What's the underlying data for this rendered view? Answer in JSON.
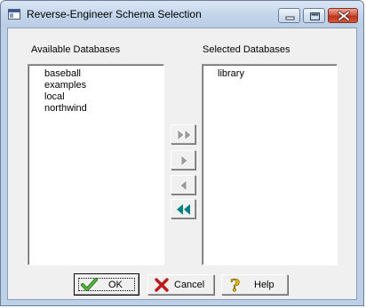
{
  "window": {
    "title": "Reverse-Engineer Schema Selection",
    "icons": {
      "app": "app-window-icon",
      "minimize": "minimize-icon",
      "maximize": "maximize-icon",
      "close": "close-icon"
    }
  },
  "available": {
    "label": "Available Databases",
    "items": [
      "baseball",
      "examples",
      "local",
      "northwind"
    ]
  },
  "selected": {
    "label": "Selected Databases",
    "items": [
      "library"
    ]
  },
  "transfer_buttons": [
    {
      "name": "add-all-button",
      "icon": "double-right-arrow-icon"
    },
    {
      "name": "add-selected-button",
      "icon": "right-arrow-icon"
    },
    {
      "name": "remove-selected-button",
      "icon": "left-arrow-icon"
    },
    {
      "name": "remove-all-button",
      "icon": "double-left-arrow-icon"
    }
  ],
  "buttons": {
    "ok_label": "OK",
    "cancel_label": "Cancel",
    "help_label": "Help"
  },
  "colors": {
    "ok_check": "#3a9a2a",
    "cancel_x": "#c01818",
    "help_q": "#e8c000",
    "active_arrow": "#008080",
    "disabled_arrow": "#9a9a9a"
  }
}
